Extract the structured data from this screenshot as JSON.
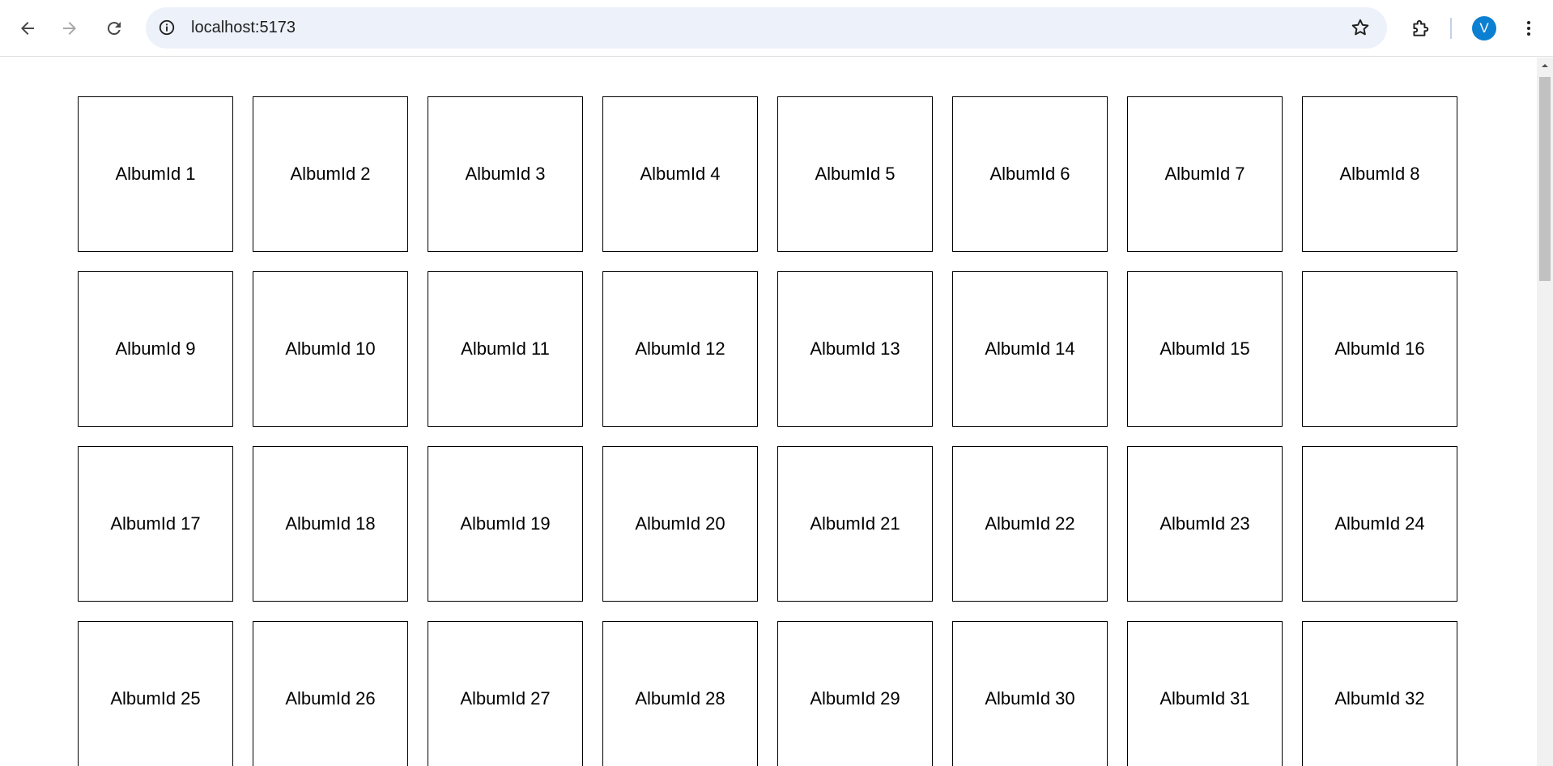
{
  "browser": {
    "url": "localhost:5173",
    "profile_initial": "V",
    "icons": {
      "back": "arrow-left-icon",
      "forward": "arrow-right-icon",
      "reload": "reload-icon",
      "site_info": "info-icon",
      "bookmark": "star-icon",
      "extensions": "puzzle-icon",
      "menu": "kebab-menu-icon"
    },
    "colors": {
      "omnibox_bg": "#edf2fa",
      "avatar_bg": "#0b7fd1"
    }
  },
  "albums": [
    "AlbumId 1",
    "AlbumId 2",
    "AlbumId 3",
    "AlbumId 4",
    "AlbumId 5",
    "AlbumId 6",
    "AlbumId 7",
    "AlbumId 8",
    "AlbumId 9",
    "AlbumId 10",
    "AlbumId 11",
    "AlbumId 12",
    "AlbumId 13",
    "AlbumId 14",
    "AlbumId 15",
    "AlbumId 16",
    "AlbumId 17",
    "AlbumId 18",
    "AlbumId 19",
    "AlbumId 20",
    "AlbumId 21",
    "AlbumId 22",
    "AlbumId 23",
    "AlbumId 24",
    "AlbumId 25",
    "AlbumId 26",
    "AlbumId 27",
    "AlbumId 28",
    "AlbumId 29",
    "AlbumId 30",
    "AlbumId 31",
    "AlbumId 32"
  ]
}
